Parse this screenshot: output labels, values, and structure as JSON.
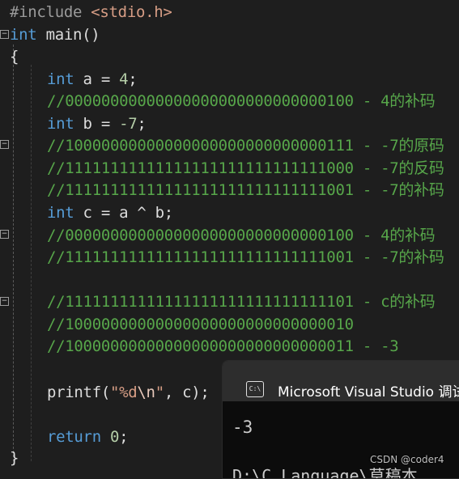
{
  "code": {
    "include": {
      "directive": "#include",
      "header": "<stdio.h>"
    },
    "main_decl": {
      "type": "int",
      "name": "main()"
    },
    "open_brace": "{",
    "close_brace": "}",
    "lines": [
      {
        "kw": "int",
        "rest": " a = ",
        "num": "4",
        "end": ";"
      },
      {
        "comment": "//00000000000000000000000000000100 - 4的补码"
      },
      {
        "kw": "int",
        "rest": " b = ",
        "num": "-7",
        "end": ";"
      },
      {
        "comment": "//10000000000000000000000000000111 - -7的原码"
      },
      {
        "comment": "//11111111111111111111111111111000 - -7的反码"
      },
      {
        "comment": "//11111111111111111111111111111001 - -7的补码"
      },
      {
        "kw": "int",
        "rest": " c = a ^ b;"
      },
      {
        "comment": "//00000000000000000000000000000100 - 4的补码"
      },
      {
        "comment": "//11111111111111111111111111111001 - -7的补码"
      },
      {
        "comment": "//11111111111111111111111111111101 - c的补码"
      },
      {
        "comment": "//10000000000000000000000000000010"
      },
      {
        "comment": "//10000000000000000000000000000011 - -3"
      }
    ],
    "printf": {
      "fn": "printf(",
      "str_open": "\"%d",
      "esc": "\\n",
      "str_close": "\"",
      "rest": ", c);"
    },
    "return": {
      "kw": "return",
      "num": "0",
      "end": ";"
    }
  },
  "console": {
    "icon_label": "C:\\",
    "title": "Microsoft Visual Studio 调试",
    "output": "-3",
    "path": "D:\\C Language\\草稿本"
  },
  "watermark": "CSDN @coder4"
}
